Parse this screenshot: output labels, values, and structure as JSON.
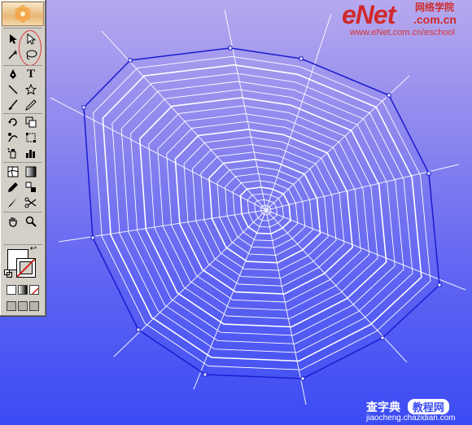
{
  "app": {
    "name": "Illustrator-style drawing workspace"
  },
  "toolbox": {
    "tools": [
      {
        "name": "selection-tool-icon"
      },
      {
        "name": "direct-selection-tool-icon"
      },
      {
        "name": "magic-wand-tool-icon"
      },
      {
        "name": "lasso-tool-icon"
      },
      {
        "name": "pen-tool-icon"
      },
      {
        "name": "type-tool-icon",
        "glyph": "T"
      },
      {
        "name": "line-segment-tool-icon"
      },
      {
        "name": "star-tool-icon"
      },
      {
        "name": "paintbrush-tool-icon"
      },
      {
        "name": "pencil-tool-icon"
      },
      {
        "name": "rotate-tool-icon"
      },
      {
        "name": "scale-tool-icon"
      },
      {
        "name": "warp-tool-icon"
      },
      {
        "name": "free-transform-tool-icon"
      },
      {
        "name": "symbol-sprayer-tool-icon"
      },
      {
        "name": "column-graph-tool-icon"
      },
      {
        "name": "mesh-tool-icon"
      },
      {
        "name": "gradient-tool-icon"
      },
      {
        "name": "eyedropper-tool-icon"
      },
      {
        "name": "blend-tool-icon"
      },
      {
        "name": "slice-tool-icon"
      },
      {
        "name": "scissors-tool-icon"
      },
      {
        "name": "hand-tool-icon"
      },
      {
        "name": "zoom-tool-icon"
      }
    ],
    "colors": {
      "fill": "#ffffff",
      "stroke": "none",
      "highlight_circle": "#d93a3a"
    }
  },
  "canvas": {
    "background_top": "#b6a9ee",
    "background_bottom": "#3b4bf4",
    "web_color": "#ffffff",
    "selected_path_color": "#1a1ad0"
  },
  "branding": {
    "logo": "eNet",
    "logo_cn": "网络学院",
    "domain": ".com.cn",
    "url": "www.eNet.com.cn/eschool",
    "footer_logo": "查字典",
    "footer_pill": "教程网",
    "footer_url": "jiaocheng.chazidian.com"
  }
}
